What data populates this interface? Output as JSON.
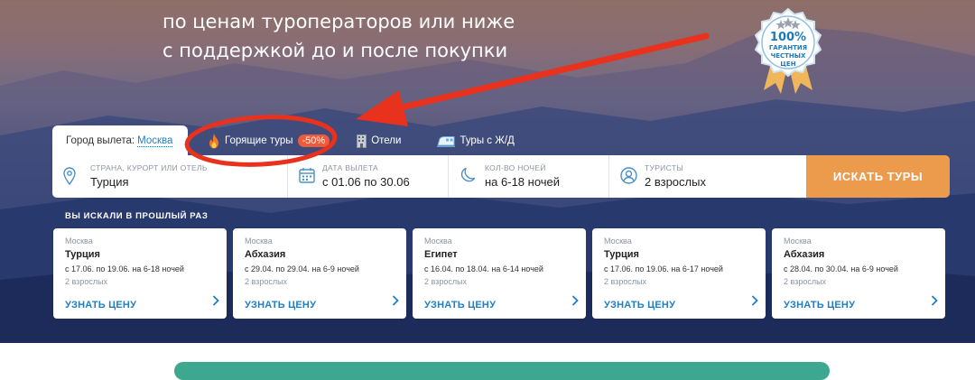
{
  "hero": {
    "line1": "по ценам туроператоров или ниже",
    "line2": "с поддержкой до и после покупки"
  },
  "badge": {
    "percent": "100%",
    "line1": "ГАРАНТИЯ",
    "line2": "ЧЕСТНЫХ",
    "line3": "ЦЕН"
  },
  "tabs": {
    "city_label": "Город вылета:",
    "city_value": "Москва",
    "hot": "Горящие туры",
    "hot_badge": "-50%",
    "hotels": "Отели",
    "trains": "Туры с Ж/Д"
  },
  "search": {
    "destination_label": "СТРАНА, КУРОРТ ИЛИ ОТЕЛЬ",
    "destination_value": "Турция",
    "dates_label": "ДАТА ВЫЛЕТА",
    "dates_value": "с 01.06 по 30.06",
    "nights_label": "КОЛ-ВО НОЧЕЙ",
    "nights_value": "на 6-18 ночей",
    "tourists_label": "ТУРИСТЫ",
    "tourists_value": "2 взрослых",
    "button": "ИСКАТЬ ТУРЫ"
  },
  "recent": {
    "title": "ВЫ ИСКАЛИ В ПРОШЛЫЙ РАЗ",
    "link_label": "УЗНАТЬ ЦЕНУ",
    "cards": [
      {
        "city": "Москва",
        "dest": "Турция",
        "dates": "с 17.06. по 19.06. на 6-18 ночей",
        "pax": "2 взрослых"
      },
      {
        "city": "Москва",
        "dest": "Абхазия",
        "dates": "с 29.04. по 29.04. на 6-9 ночей",
        "pax": "2 взрослых"
      },
      {
        "city": "Москва",
        "dest": "Египет",
        "dates": "с 16.04. по 18.04. на 6-14 ночей",
        "pax": "2 взрослых"
      },
      {
        "city": "Москва",
        "dest": "Турция",
        "dates": "с 17.06. по 19.06. на 6-17 ночей",
        "pax": "2 взрослых"
      },
      {
        "city": "Москва",
        "dest": "Абхазия",
        "dates": "с 28.04. по 30.04. на 6-9 ночей",
        "pax": "2 взрослых"
      }
    ]
  },
  "colors": {
    "accent_blue": "#1f7fc3",
    "search_button": "#ec9a4c",
    "hot_badge": "#ee5b3c",
    "annotation_red": "#e8321e"
  }
}
